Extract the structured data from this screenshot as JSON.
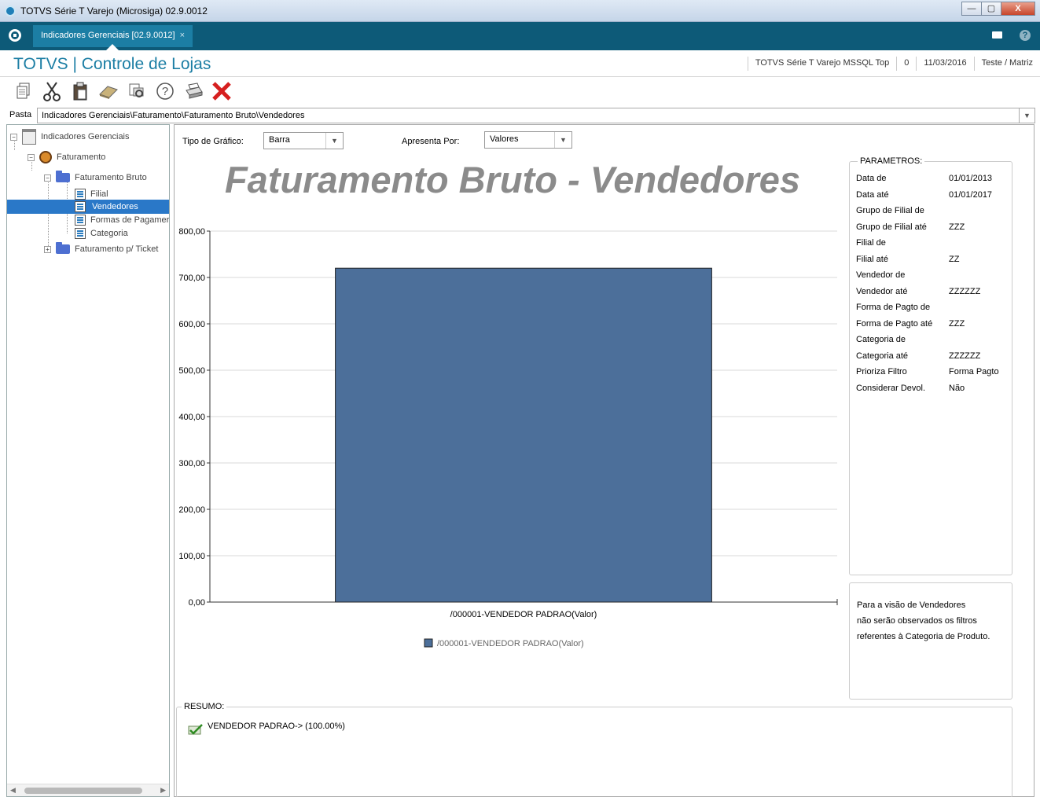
{
  "window": {
    "title": "TOTVS Série T Varejo (Microsiga) 02.9.0012",
    "buttons": {
      "minimize": "—",
      "maximize": "▢",
      "close": "X"
    }
  },
  "tabbar": {
    "tab_label": "Indicadores Gerenciais [02.9.0012]",
    "tab_close": "×",
    "help": "?"
  },
  "header": {
    "brand": "TOTVS | Controle de Lojas",
    "info": [
      "TOTVS Série T Varejo MSSQL Top",
      "0",
      "11/03/2016",
      "Teste / Matriz"
    ]
  },
  "toolbar": {
    "icons": [
      "copy-icon",
      "cut-icon",
      "paste-icon",
      "eraser-icon",
      "print-preview-icon",
      "help-icon",
      "print-icon",
      "close-icon"
    ]
  },
  "pasta": {
    "label": "Pasta",
    "value": "Indicadores Gerenciais\\Faturamento\\Faturamento Bruto\\Vendedores"
  },
  "tree": {
    "nodes": [
      {
        "label": "Indicadores Gerenciais",
        "level": 0,
        "icon": "report-icon",
        "expand": "⊟"
      },
      {
        "label": "Faturamento",
        "level": 1,
        "icon": "person-icon",
        "expand": "⊟"
      },
      {
        "label": "Faturamento Bruto",
        "level": 2,
        "icon": "folder-icon",
        "expand": "⊟"
      },
      {
        "label": "Filial",
        "level": 3,
        "icon": "sheet-icon"
      },
      {
        "label": "Vendedores",
        "level": 3,
        "icon": "sheet-icon",
        "selected": true
      },
      {
        "label": "Formas de Pagamer",
        "level": 3,
        "icon": "sheet-icon"
      },
      {
        "label": "Categoria",
        "level": 3,
        "icon": "sheet-icon"
      },
      {
        "label": "Faturamento p/ Ticket",
        "level": 2,
        "icon": "folder-icon",
        "expand": "⊞"
      }
    ]
  },
  "controls": {
    "tipo_label": "Tipo de Gráfico:",
    "tipo_value": "Barra",
    "apresenta_label": "Apresenta Por:",
    "apresenta_value": "Valores"
  },
  "chart_data": {
    "type": "bar",
    "title": "Faturamento Bruto - Vendedores",
    "categories": [
      "/000001-VENDEDOR PADRAO(Valor)"
    ],
    "series": [
      {
        "name": "/000001-VENDEDOR PADRAO(Valor)",
        "values": [
          720
        ],
        "color": "#4c6f9a"
      }
    ],
    "ylim": [
      0,
      800
    ],
    "yticks": [
      "0,00",
      "100,00",
      "200,00",
      "300,00",
      "400,00",
      "500,00",
      "600,00",
      "700,00",
      "800,00"
    ],
    "grid": true,
    "legend": "bottom"
  },
  "parametros": {
    "title": "PARAMETROS:",
    "rows": [
      {
        "label": "Data de",
        "value": "01/01/2013"
      },
      {
        "label": "Data até",
        "value": "01/01/2017"
      },
      {
        "label": "Grupo de Filial de",
        "value": ""
      },
      {
        "label": "Grupo de Filial até",
        "value": "ZZZ"
      },
      {
        "label": "Filial de",
        "value": ""
      },
      {
        "label": "Filial até",
        "value": "ZZ"
      },
      {
        "label": "Vendedor de",
        "value": ""
      },
      {
        "label": "Vendedor até",
        "value": "ZZZZZZ"
      },
      {
        "label": "Forma de Pagto de",
        "value": ""
      },
      {
        "label": "Forma de Pagto até",
        "value": "ZZZ"
      },
      {
        "label": "Categoria de",
        "value": ""
      },
      {
        "label": "Categoria até",
        "value": "ZZZZZZ"
      },
      {
        "label": "Prioriza Filtro",
        "value": "Forma Pagto"
      },
      {
        "label": "Considerar Devol.",
        "value": "Não"
      }
    ]
  },
  "note": {
    "lines": [
      "Para a visão de Vendedores",
      "não serão observados os filtros",
      "referentes à Categoria de Produto."
    ]
  },
  "resumo": {
    "title": "RESUMO:",
    "text": "VENDEDOR PADRAO-> (100.00%)"
  }
}
